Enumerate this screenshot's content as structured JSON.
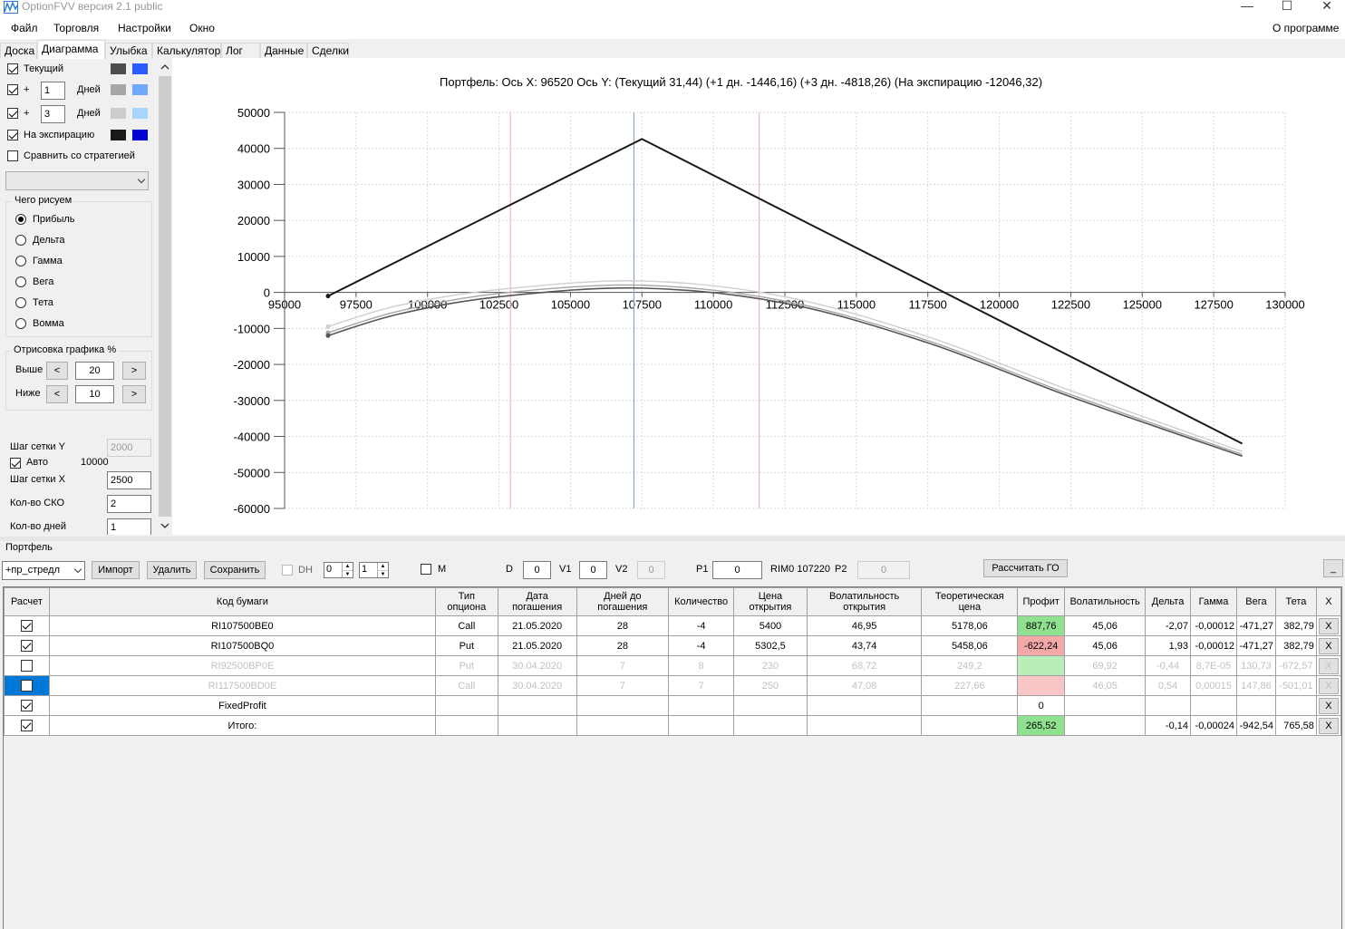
{
  "app": {
    "title": "OptionFVV версия 2.1 public"
  },
  "menu": {
    "items": [
      "Файл",
      "Торговля",
      "Настройки",
      "Окно"
    ],
    "about": "О программе"
  },
  "tabs": [
    "Доска",
    "Диаграмма",
    "Улыбка",
    "Калькулятор",
    "Лог",
    "Данные",
    "Сделки"
  ],
  "active_tab": "Диаграмма",
  "left": {
    "current_label": "Текущий",
    "plus": "+",
    "days_label": "Дней",
    "days1": "1",
    "days2": "3",
    "expiry_label": "На экспирацию",
    "compare_label": "Сравнить со стратегией",
    "draw_group": "Чего рисуем",
    "draw_options": [
      "Прибыль",
      "Дельта",
      "Гамма",
      "Вега",
      "Тета",
      "Вомма"
    ],
    "selected_option": "Прибыль",
    "render_group": "Отрисовка графика %",
    "above_label": "Выше",
    "above_value": "20",
    "below_label": "Ниже",
    "below_value": "10",
    "btn_prev": "<",
    "btn_next": ">",
    "grid_y_label": "Шаг сетки Y",
    "grid_y_value": "2000",
    "auto_label": "Авто",
    "auto_value": "10000",
    "grid_x_label": "Шаг сетки X",
    "grid_x_value": "2500",
    "sko_label": "Кол-во СКО",
    "sko_value": "2",
    "days_count_label": "Кол-во дней",
    "days_count_value": "1",
    "colors": {
      "current": [
        "#4d4d4d",
        "#2b5cff"
      ],
      "plus1": [
        "#a6a6a6",
        "#6fa8ff"
      ],
      "plus3": [
        "#cccccc",
        "#a8d4ff"
      ],
      "expiry": [
        "#1a1a1a",
        "#0000d0"
      ]
    }
  },
  "chart_data": {
    "type": "line",
    "title": "Портфель: Ось X: 96520 Ось Y:  (Текущий 31,44)  (+1 дн. -1446,16)  (+3 дн. -4818,26)  (На экспирацию -12046,32)",
    "x_ticks": [
      "95000",
      "97500",
      "100000",
      "102500",
      "105000",
      "107500",
      "110000",
      "112500",
      "115000",
      "117500",
      "120000",
      "122500",
      "125000",
      "127500",
      "130000"
    ],
    "y_ticks": [
      "50000",
      "40000",
      "30000",
      "20000",
      "10000",
      "0",
      "-10000",
      "-20000",
      "-30000",
      "-40000",
      "-50000",
      "-60000"
    ],
    "xlim": [
      95000,
      130000
    ],
    "ylim": [
      -60000,
      50000
    ],
    "vlines": [
      {
        "x": 102900,
        "color": "#f4b6c2"
      },
      {
        "x": 107220,
        "color": "#8aa9c8"
      },
      {
        "x": 111600,
        "color": "#f4b6c2"
      }
    ],
    "series": [
      {
        "name": "На экспирацию",
        "color": "#1a1a1a",
        "x": [
          96520,
          107500,
          128500
        ],
        "y": [
          -1000,
          42600,
          -42000
        ]
      },
      {
        "name": "Текущий",
        "color": "#555555",
        "x": [
          96520,
          99000,
          102500,
          107500,
          112500,
          117500,
          122500,
          128500
        ],
        "y": [
          -12000,
          -6000,
          -1200,
          1200,
          -3000,
          -14000,
          -29000,
          -45500
        ]
      },
      {
        "name": "+1 дн.",
        "color": "#a6a6a6",
        "x": [
          96520,
          99000,
          102500,
          107500,
          112500,
          117500,
          122500,
          128500
        ],
        "y": [
          -11200,
          -5200,
          -300,
          2000,
          -2400,
          -13400,
          -28400,
          -45000
        ]
      },
      {
        "name": "+3 дн.",
        "color": "#cfcfcf",
        "x": [
          96520,
          99000,
          102500,
          107500,
          112500,
          117500,
          122500,
          128500
        ],
        "y": [
          -9500,
          -3600,
          800,
          3200,
          -1200,
          -12300,
          -27300,
          -44200
        ]
      }
    ],
    "grid": true
  },
  "portfolio": {
    "label": "Портфель",
    "strategy": "+пр_стредл",
    "import": "Импорт",
    "delete": "Удалить",
    "save": "Сохранить",
    "dh": "DH",
    "spin1": "0",
    "spin2": "1",
    "m": "M",
    "d_label": "D",
    "d_value": "0",
    "v1_label": "V1",
    "v1_value": "0",
    "v2_label": "V2",
    "v2_value": "0",
    "p1_label": "P1",
    "p1_value": "0",
    "rim": "RIM0 107220",
    "p2_label": "P2",
    "p2_value": "0",
    "calc_go": "Рассчитать ГО",
    "minimize": "_"
  },
  "table": {
    "headers": [
      "Расчет",
      "Код бумаги",
      "Тип\nопциона",
      "Дата\nпогашения",
      "Дней до\nпогашения",
      "Количество",
      "Цена\nоткрытия",
      "Волатильность\nоткрытия",
      "Теоретическая\nцена",
      "Профит",
      "Волатильность",
      "Дельта",
      "Гамма",
      "Вега",
      "Тета",
      "X"
    ],
    "rows": [
      {
        "checked": true,
        "dim": false,
        "cells": [
          "RI107500BE0",
          "Call",
          "21.05.2020",
          "28",
          "-4",
          "5400",
          "46,95",
          "5178,06",
          "887,76",
          "45,06",
          "-2,07",
          "-0,00012",
          "-471,27",
          "382,79"
        ],
        "profit_class": "pos"
      },
      {
        "checked": true,
        "dim": false,
        "cells": [
          "RI107500BQ0",
          "Put",
          "21.05.2020",
          "28",
          "-4",
          "5302,5",
          "43,74",
          "5458,06",
          "-622,24",
          "45,06",
          "1,93",
          "-0,00012",
          "-471,27",
          "382,79"
        ],
        "profit_class": "neg"
      },
      {
        "checked": false,
        "dim": true,
        "cells": [
          "RI92500BP0E",
          "Put",
          "30.04.2020",
          "7",
          "8",
          "230",
          "68,72",
          "249,2",
          "",
          "69,92",
          "-0,44",
          "8,7E-05",
          "130,73",
          "-672,57"
        ],
        "profit_class": "posdim"
      },
      {
        "checked": false,
        "dim": true,
        "selected": true,
        "cells": [
          "RI117500BD0E",
          "Call",
          "30.04.2020",
          "7",
          "7",
          "250",
          "47,08",
          "227,66",
          "",
          "46,05",
          "0,54",
          "0,00015",
          "147,86",
          "-501,01"
        ],
        "profit_class": "negdim"
      },
      {
        "checked": true,
        "dim": false,
        "cells": [
          "FixedProfit",
          "",
          "",
          "",
          "",
          "",
          "",
          "",
          "0",
          "",
          "",
          "",
          "",
          ""
        ],
        "profit_class": ""
      },
      {
        "checked": true,
        "dim": false,
        "cells": [
          "Итого:",
          "",
          "",
          "",
          "",
          "",
          "",
          "",
          "265,52",
          "",
          "-0,14",
          "-0,00024",
          "-942,54",
          "765,58"
        ],
        "profit_class": "pos"
      }
    ],
    "x_label": "X"
  }
}
